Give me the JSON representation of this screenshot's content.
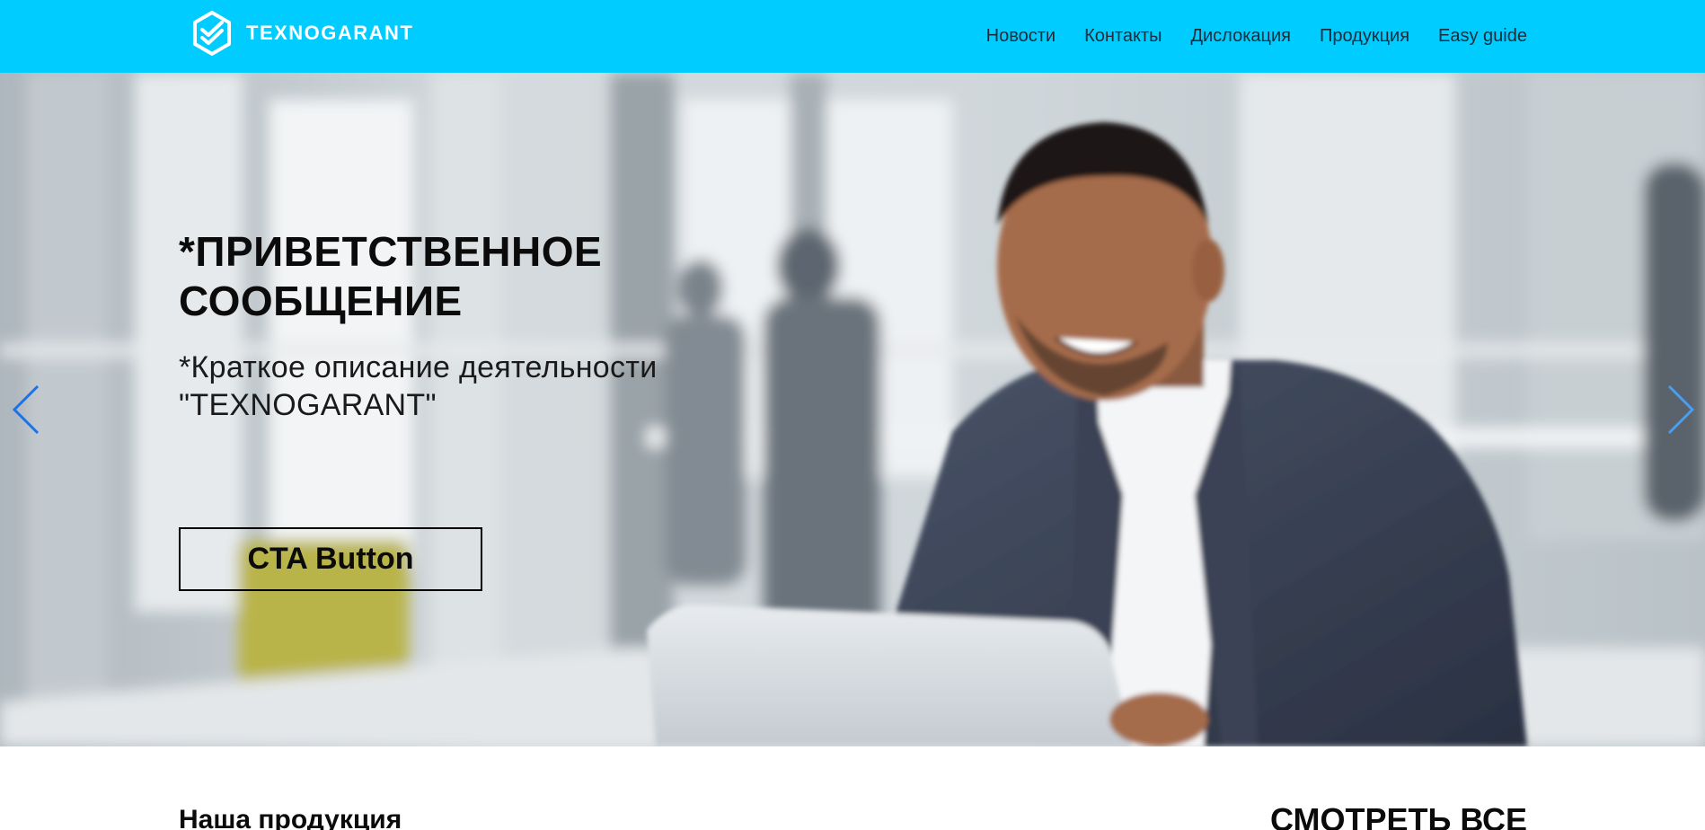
{
  "header": {
    "logo_text": "TEXNOGARANT",
    "nav": [
      {
        "label": "Новости"
      },
      {
        "label": "Контакты"
      },
      {
        "label": "Дислокация"
      },
      {
        "label": "Продукция"
      },
      {
        "label": "Easy guide"
      }
    ]
  },
  "hero": {
    "title_line1": "*ПРИВЕТСТВЕННОЕ",
    "title_line2": "СООБЩЕНИЕ",
    "subtitle_line1": "*Краткое описание деятельности",
    "subtitle_line2": "\"TEXNOGARANT\"",
    "cta_label": "CTA Button",
    "arrow_left_icon": "chevron-left-icon",
    "arrow_right_icon": "chevron-right-icon"
  },
  "products": {
    "title": "Наша продукция",
    "see_all_label": "СМОТРЕТЬ ВСЕ"
  },
  "colors": {
    "header_bg": "#00ccff",
    "arrow": "#1a73e8",
    "text_dark": "#0b0b0b"
  }
}
